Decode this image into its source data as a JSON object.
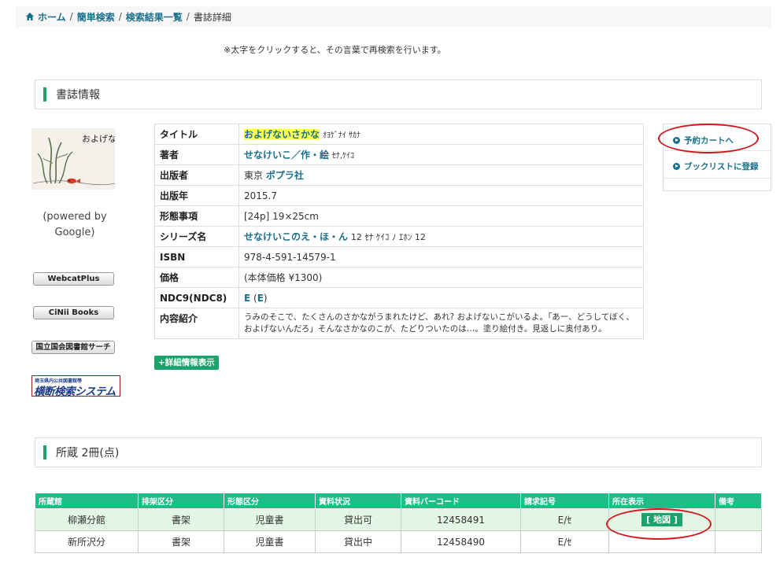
{
  "breadcrumb": {
    "home": "ホーム",
    "simple_search": "簡単検索",
    "results": "検索結果一覧",
    "current": "書誌詳細",
    "separator": "/"
  },
  "note": "※太字をクリックすると、その言葉で再検索を行います。",
  "bib_section_title": "書誌情報",
  "cover_image": {
    "handwritten_title": "およげない さかな"
  },
  "powered_by": "(powered by Google)",
  "external_links": [
    "WebcatPlus",
    "CiNii Books",
    "国立国会図書館サーチ"
  ],
  "saitama_banner": {
    "small": "埼玉県内公共図書館等",
    "big": "横断検索システム"
  },
  "detail": {
    "title_label": "タイトル",
    "title": "およげないさかな",
    "title_kana": "ｵﾖｹﾞﾅｲ ｻｶﾅ",
    "author_label": "著者",
    "author": "せなけいこ／作・絵",
    "author_kana": "ｾﾅ,ｹｲｺ",
    "publisher_label": "出版者",
    "publisher_place": "東京",
    "publisher": "ポプラ社",
    "year_label": "出版年",
    "year": "2015.7",
    "form_label": "形態事項",
    "form": "[24p] 19×25cm",
    "series_label": "シリーズ名",
    "series": "せなけいこのえ・ほ・ん",
    "series_rest": "12 ｾﾅ ｹｲｺ ﾉ ｴﾎﾝ 12",
    "isbn_label": "ISBN",
    "isbn": "978-4-591-14579-1",
    "price_label": "価格",
    "price": "(本体価格 ¥1300)",
    "ndc_label": "NDC9(NDC8)",
    "ndc": "E",
    "ndc_paren_open": "(",
    "ndc8": "E",
    "ndc_paren_close": ")",
    "summary_label": "内容紹介",
    "summary": "うみのそこで、たくさんのさかながうまれたけど、あれ? およげないこがいるよ。「あー、どうしてぼく、およげないんだろ」そんなさかなのこが、たどりついたのは…。塗り絵付き。見返しに奥付あり。"
  },
  "more_button": "+詳細情報表示",
  "actions": {
    "reserve": "予約カートへ",
    "booklist": "ブックリストに登録"
  },
  "holdings_section_title": "所蔵 2冊(点)",
  "holdings": {
    "headers": [
      "所蔵館",
      "排架区分",
      "形態区分",
      "資料状況",
      "資料バーコード",
      "請求記号",
      "所在表示",
      "備考"
    ],
    "rows": [
      [
        "柳瀬分館",
        "書架",
        "児童書",
        "貸出可",
        "12458491",
        "E/ｾ",
        "[ 地図 ]",
        ""
      ],
      [
        "新所沢分",
        "書架",
        "児童書",
        "貸出中",
        "12458490",
        "E/ｾ",
        "",
        ""
      ]
    ]
  },
  "colors": {
    "accent_green": "#1aa36a",
    "header_green": "#1dbd86",
    "link": "#1a6f8a",
    "highlight_yellow": "#ffff55",
    "annotation_red": "#d4151b"
  }
}
